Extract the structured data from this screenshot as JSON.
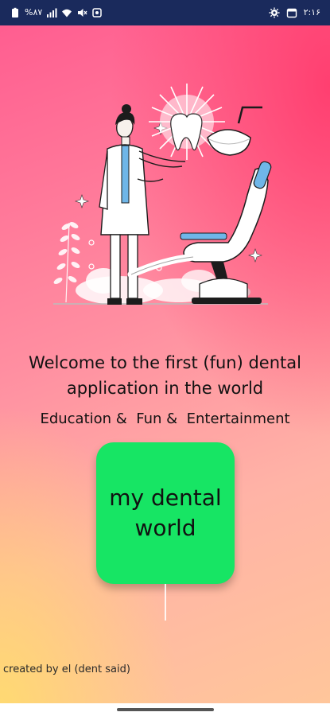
{
  "status_bar": {
    "left_text": "%۸۷",
    "time": "۲:۱۶",
    "icons_left": [
      "battery-icon",
      "signal-bars-icon",
      "wifi-icon",
      "mute-icon",
      "notification-icon"
    ],
    "icons_right": [
      "settings-gear-icon",
      "calendar-icon"
    ]
  },
  "illustration": {
    "name": "dentist-with-tooth-and-chair-illustration",
    "colors": {
      "lamp_glow": "#ffffff",
      "accent_blue": "#6fb6e8",
      "outline": "#1c1c1c"
    }
  },
  "welcome": {
    "line1": "Welcome to the first (fun) dental",
    "line2": "application in the world"
  },
  "subtitle": "Education &  Fun &  Entertainment",
  "main_button": {
    "line1": "my dental",
    "line2": "world",
    "color": "#17e564"
  },
  "footer": {
    "credit": "created by el (dent said)"
  }
}
